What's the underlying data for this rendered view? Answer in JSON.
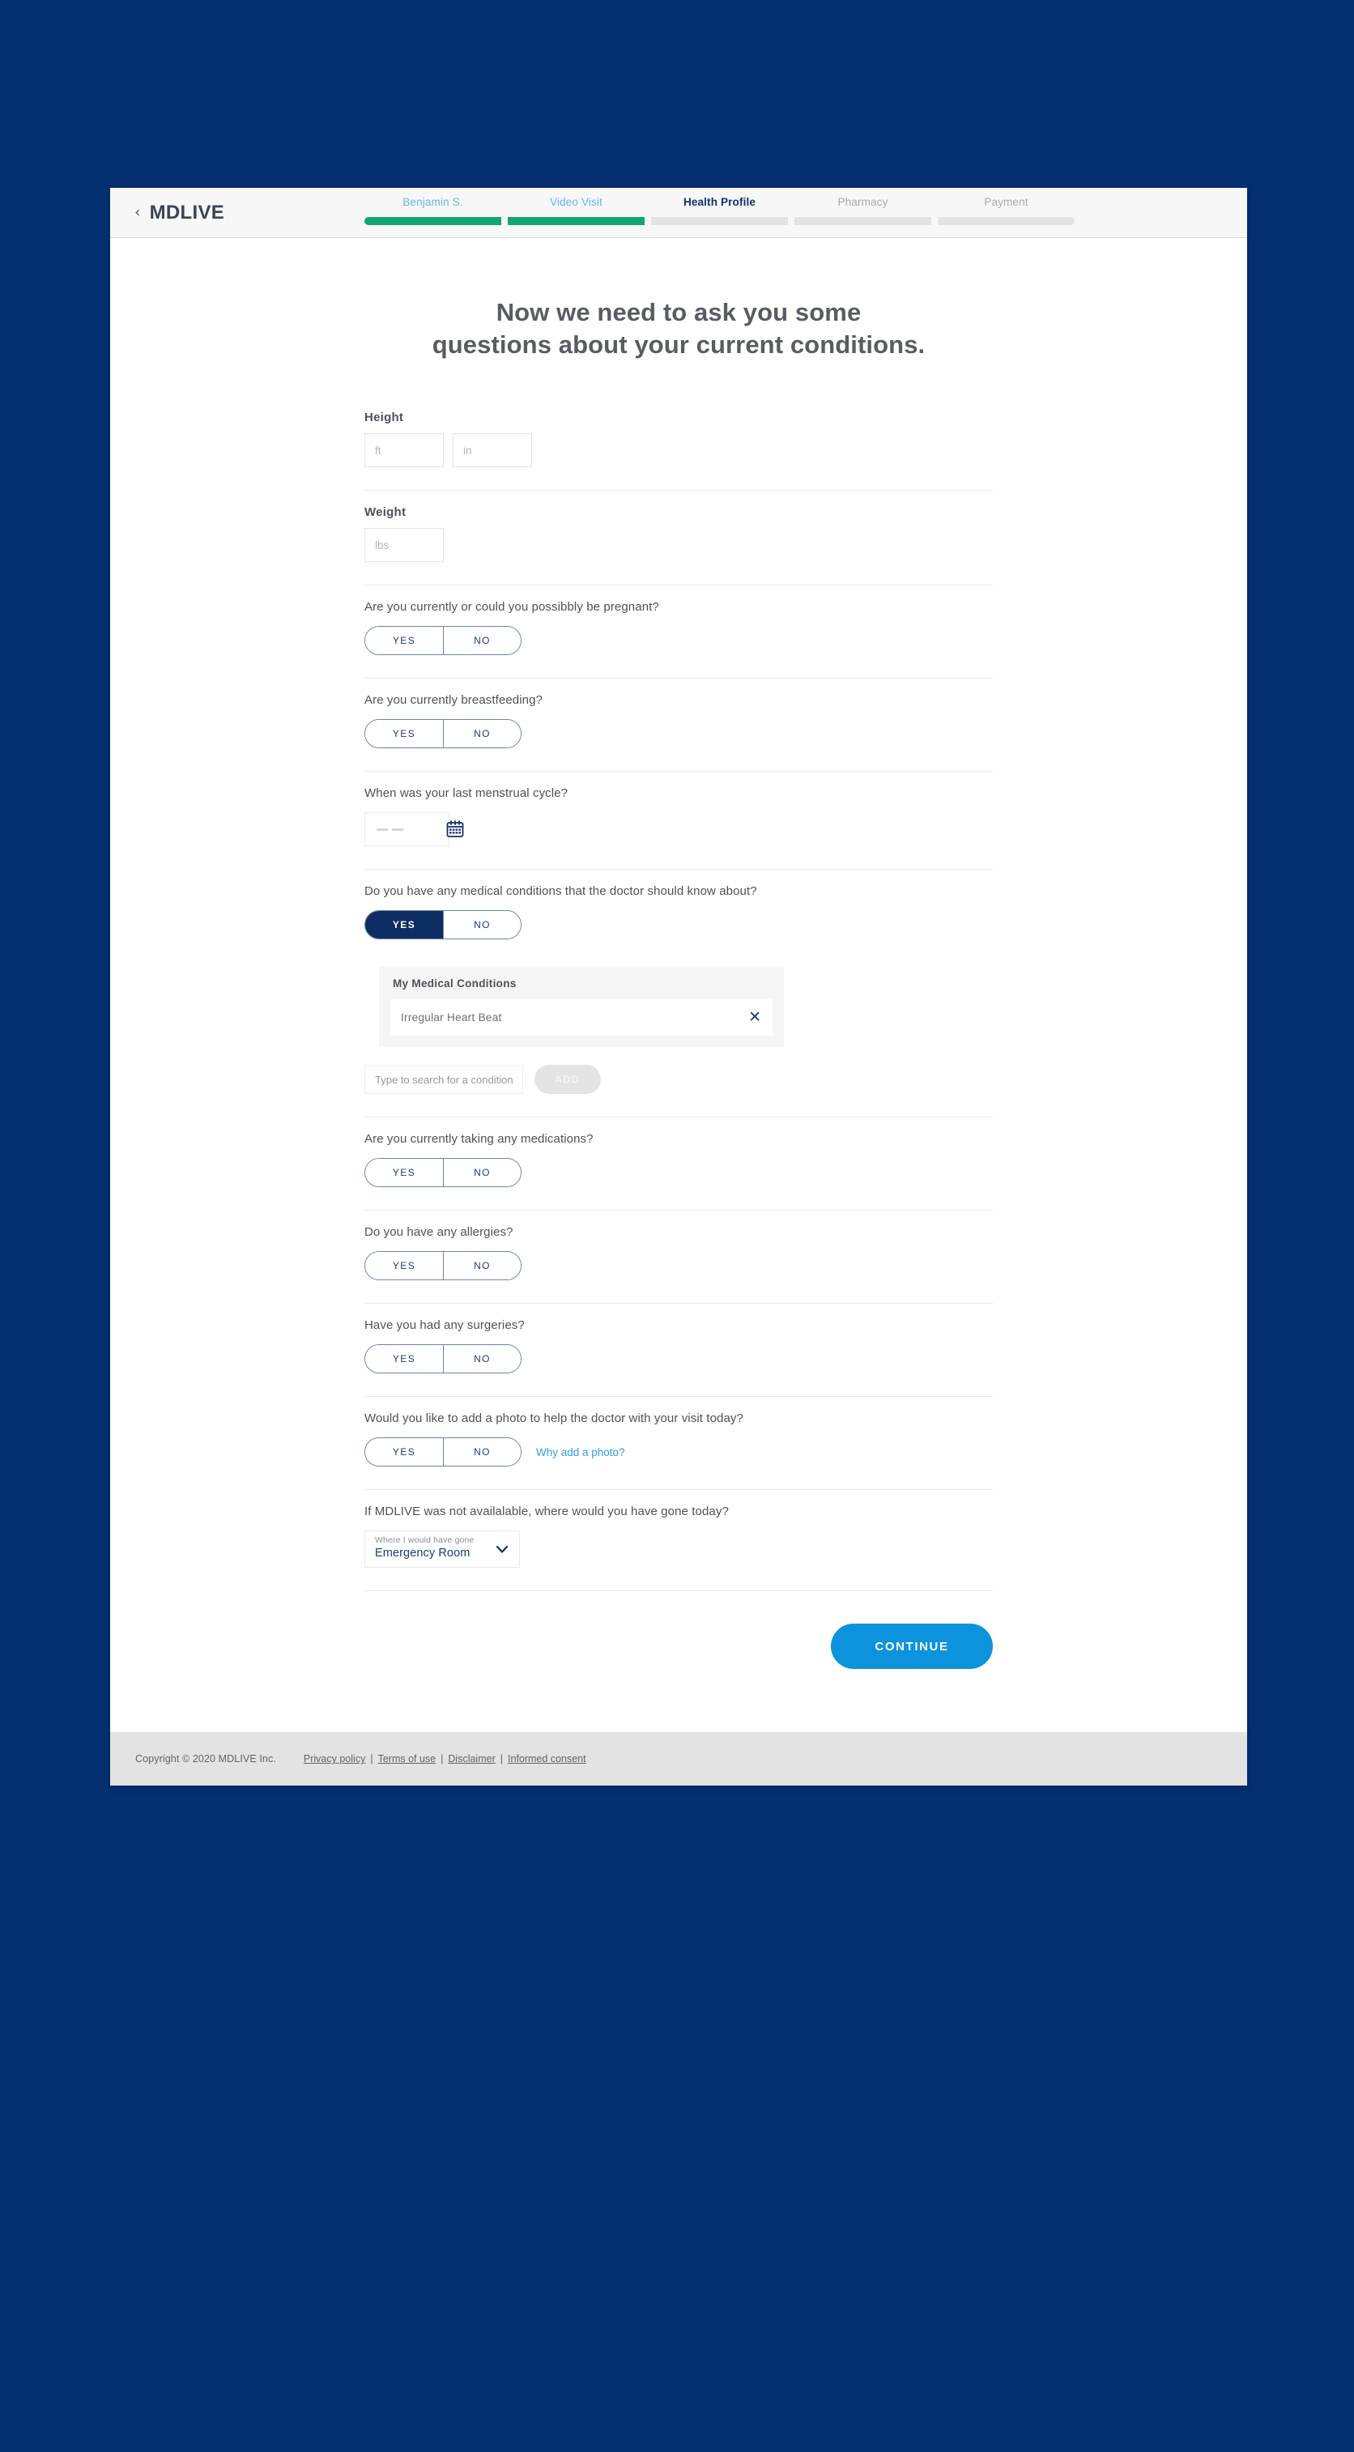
{
  "header": {
    "back_chevron": "chevron-left-icon",
    "brand": "MDLIVE",
    "steps": [
      {
        "label": "Benjamin S.",
        "state": "done"
      },
      {
        "label": "Video Visit",
        "state": "done"
      },
      {
        "label": "Health Profile",
        "state": "active"
      },
      {
        "label": "Pharmacy",
        "state": "upcoming"
      },
      {
        "label": "Payment",
        "state": "upcoming"
      }
    ]
  },
  "main": {
    "title_line1": "Now we need to ask you some",
    "title_line2": "questions about your current conditions.",
    "height": {
      "label": "Height",
      "ft_value": "",
      "ft_placeholder": "ft",
      "in_value": "",
      "in_placeholder": "in"
    },
    "weight": {
      "label": "Weight",
      "value": "",
      "placeholder": "lbs"
    },
    "pregnant": {
      "question": "Are you currently or could you possibbly be pregnant?",
      "yes": "YES",
      "no": "NO",
      "selected": ""
    },
    "breastfeeding": {
      "question": "Are you currently breastfeeding?",
      "yes": "YES",
      "no": "NO",
      "selected": ""
    },
    "menstrual": {
      "question": "When was your last menstrual cycle?",
      "value": "",
      "calendar_icon": "calendar-icon"
    },
    "conditions": {
      "question": "Do you have any medical conditions that the doctor should know about?",
      "yes": "YES",
      "no": "NO",
      "selected": "YES",
      "panel_title": "My Medical Conditions",
      "items": [
        {
          "name": "Irregular Heart Beat",
          "remove_icon": "close-icon"
        }
      ],
      "search_value": "",
      "search_placeholder": "Type to search for a condition",
      "add_label": "ADD"
    },
    "medications": {
      "question": "Are you currently taking any medications?",
      "yes": "YES",
      "no": "NO",
      "selected": ""
    },
    "allergies": {
      "question": "Do you have any allergies?",
      "yes": "YES",
      "no": "NO",
      "selected": ""
    },
    "surgeries": {
      "question": "Have you had any surgeries?",
      "yes": "YES",
      "no": "NO",
      "selected": ""
    },
    "photo": {
      "question": "Would you like to add a photo to help the doctor with your visit today?",
      "yes": "YES",
      "no": "NO",
      "selected": "",
      "link": "Why add a photo?"
    },
    "alternative": {
      "question": "If MDLIVE was not availalable, where would you have gone today?",
      "select_caption": "Where I would have gone",
      "select_value": "Emergency Room",
      "chevron_icon": "chevron-down-icon"
    },
    "continue_label": "CONTINUE"
  },
  "footer": {
    "copyright": "Copyright © 2020 MDLIVE Inc.",
    "links": [
      "Privacy policy",
      "Terms of use",
      "Disclaimer",
      "Informed consent"
    ],
    "separator": "|"
  },
  "colors": {
    "page_background": "#042f71",
    "progress_done": "#13a474",
    "progress_todo": "#e3e3e3",
    "accent_blue": "#0c93dc",
    "navy": "#0d2d62",
    "link_blue": "#2e9fdd"
  }
}
